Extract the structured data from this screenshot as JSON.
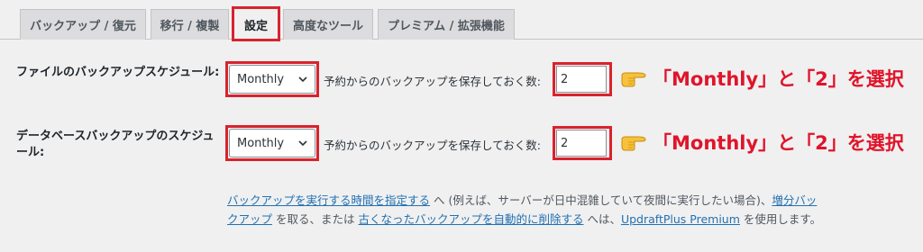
{
  "tabs": [
    {
      "label": "バックアップ / 復元"
    },
    {
      "label": "移行 / 複製"
    },
    {
      "label": "設定"
    },
    {
      "label": "高度なツール"
    },
    {
      "label": "プレミアム / 拡張機能"
    }
  ],
  "active_tab": "設定",
  "rows": [
    {
      "label": "ファイルのバックアップスケジュール:",
      "schedule_value": "Monthly",
      "retain_label": "予約からのバックアップを保存しておく数:",
      "retain_value": "2",
      "annotation": "「Monthly」と「2」を選択"
    },
    {
      "label": "データベースバックアップのスケジュール:",
      "schedule_value": "Monthly",
      "retain_label": "予約からのバックアップを保存しておく数:",
      "retain_value": "2",
      "annotation": "「Monthly」と「2」を選択"
    }
  ],
  "note": {
    "link1": "バックアップを実行する時間を指定する",
    "text1": " へ (例えば、サーバーが日中混雑していて夜間に実行したい場合)、",
    "link2": "増分バックアップ",
    "text2": " を取る、または ",
    "link3": "古くなったバックアップを自動的に削除する",
    "text3": " へは、",
    "link4": "UpdraftPlus Premium",
    "text4": " を使用します。"
  },
  "colors": {
    "highlight": "#d9232d",
    "annotation": "#e0142a",
    "link": "#2271b1"
  },
  "icons": {
    "pointer": "pointing-hand-icon",
    "dropdown": "chevron-down-icon"
  }
}
